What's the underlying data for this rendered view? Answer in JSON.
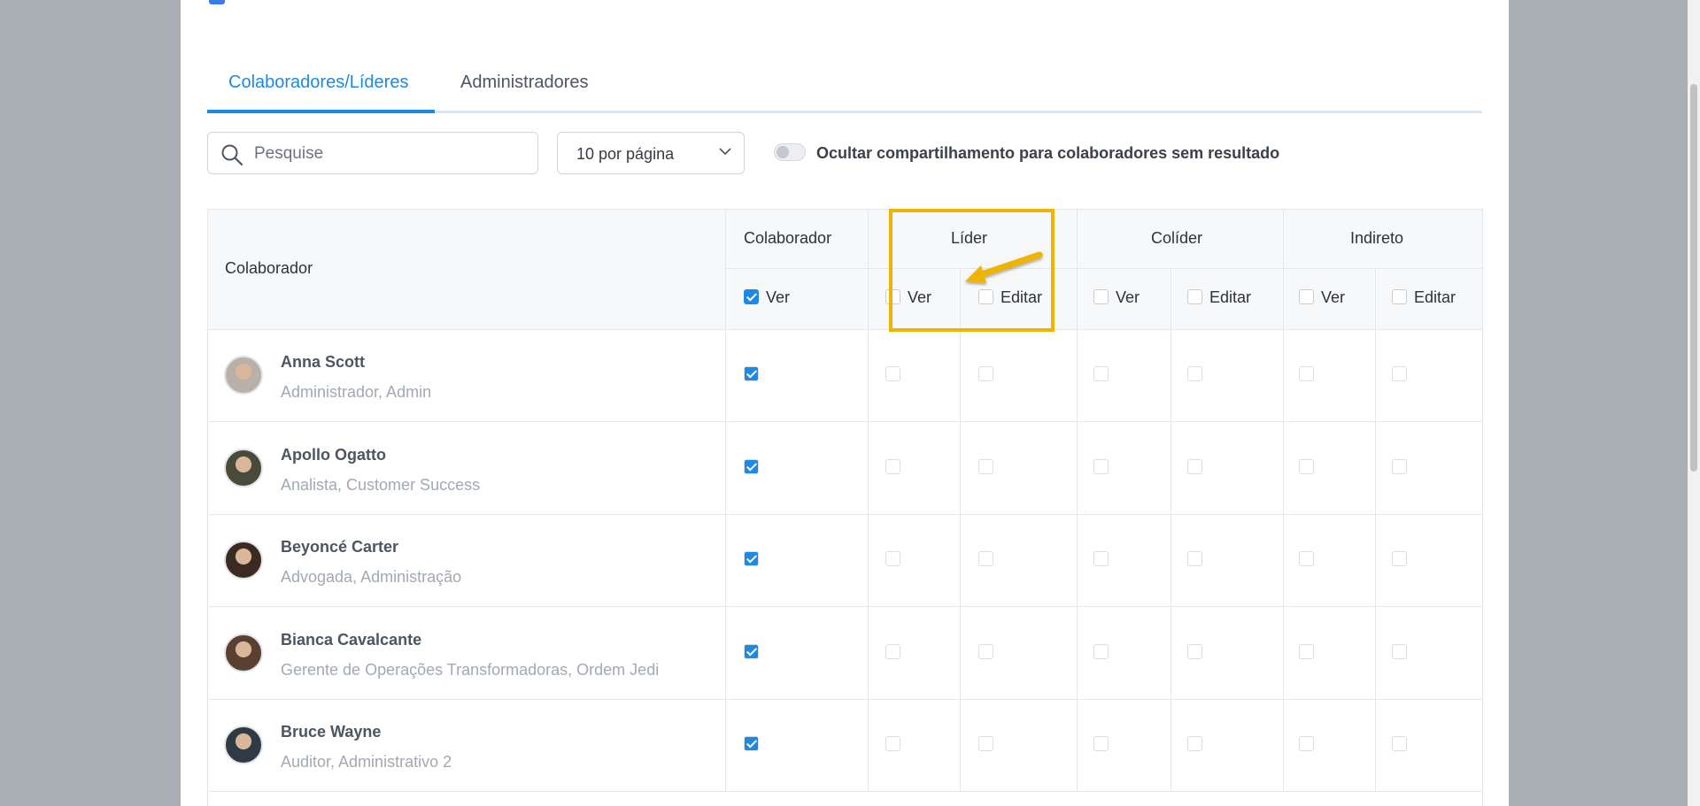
{
  "tabs": [
    {
      "label": "Colaboradores/Líderes",
      "active": true
    },
    {
      "label": "Administradores",
      "active": false
    }
  ],
  "toolbar": {
    "search_placeholder": "Pesquise",
    "per_page": "10 por página",
    "toggle_label": "Ocultar compartilhamento para colaboradores sem resultado",
    "toggle_on": false
  },
  "table": {
    "col_collaborator": "Colaborador",
    "groups": [
      "Colaborador",
      "Líder",
      "Colíder",
      "Indireto"
    ],
    "sub": {
      "view": "Ver",
      "edit": "Editar"
    },
    "rows": [
      {
        "name": "Anna Scott",
        "role": "Administrador, Admin"
      },
      {
        "name": "Apollo Ogatto",
        "role": "Analista, Customer Success"
      },
      {
        "name": "Beyoncé Carter",
        "role": "Advogada, Administração"
      },
      {
        "name": "Bianca Cavalcante",
        "role": "Gerente de Operações Transformadoras, Ordem Jedi"
      },
      {
        "name": "Bruce Wayne",
        "role": "Auditor, Administrativo 2"
      }
    ]
  },
  "colors": {
    "accent": "#1b8ae6",
    "highlight": "#f0b400"
  }
}
